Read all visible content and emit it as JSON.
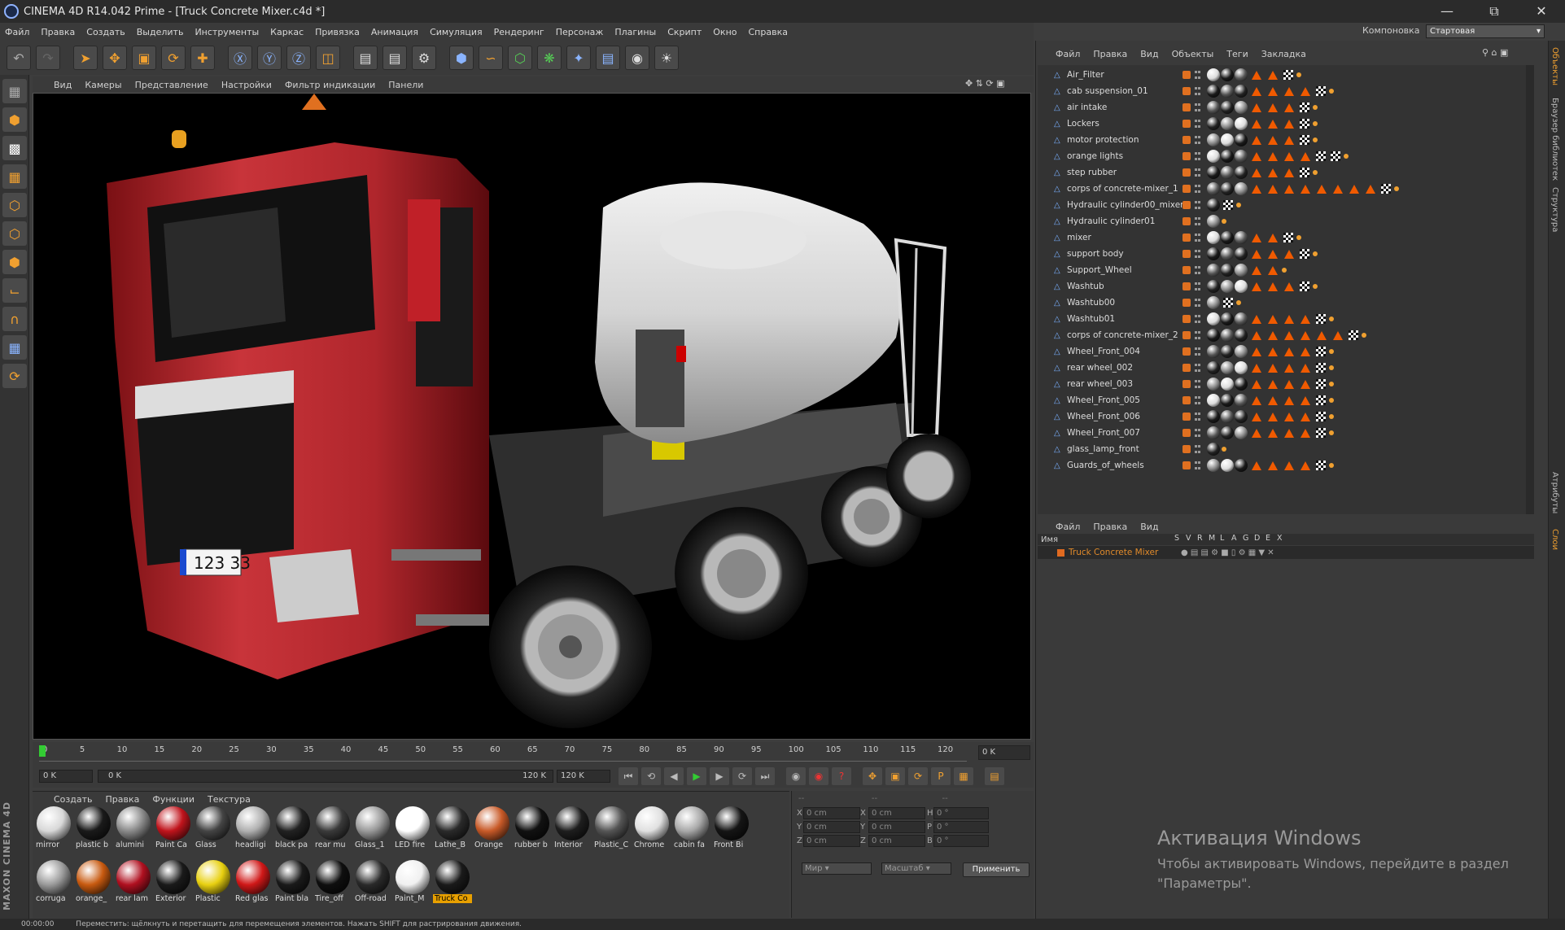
{
  "window": {
    "title": "CINEMA 4D R14.042 Prime - [Truck Concrete Mixer.c4d *]",
    "minimize_icon": "minimize-icon",
    "maximize_icon": "restore-icon",
    "close_icon": "close-icon"
  },
  "menubar": [
    "Файл",
    "Правка",
    "Создать",
    "Выделить",
    "Инструменты",
    "Каркас",
    "Привязка",
    "Анимация",
    "Симуляция",
    "Рендеринг",
    "Персонаж",
    "Плагины",
    "Скрипт",
    "Окно",
    "Справка"
  ],
  "layout": {
    "label": "Компоновка",
    "value": "Стартовая"
  },
  "viewport": {
    "menu": [
      "Вид",
      "Камеры",
      "Представление",
      "Настройки",
      "Фильтр индикации",
      "Панели"
    ],
    "plate": "123 33"
  },
  "timeline": {
    "ticks": [
      "0",
      "5",
      "10",
      "15",
      "20",
      "25",
      "30",
      "35",
      "40",
      "45",
      "50",
      "55",
      "60",
      "65",
      "70",
      "75",
      "80",
      "85",
      "90",
      "95",
      "100",
      "105",
      "110",
      "115",
      "120"
    ],
    "current_frame": "0 K",
    "start": "0 K",
    "range_start": "0 K",
    "range_end": "120 K",
    "end": "120 K"
  },
  "materials": {
    "menu": [
      "Создать",
      "Правка",
      "Функции",
      "Текстура"
    ],
    "items": [
      {
        "label": "mirror",
        "color": "#d8d8d8"
      },
      {
        "label": "plastic b",
        "color": "#1a1a1a"
      },
      {
        "label": "alumini",
        "color": "#8a8a8a"
      },
      {
        "label": "Paint Ca",
        "color": "#c0141c"
      },
      {
        "label": "Glass",
        "color": "#444444"
      },
      {
        "label": "headligi",
        "color": "#b0b0b0"
      },
      {
        "label": "black pa",
        "color": "#222222"
      },
      {
        "label": "rear mu",
        "color": "#3a3a3a"
      },
      {
        "label": "Glass_1",
        "color": "#9a9a9a"
      },
      {
        "label": "LED fire",
        "color": "#ffffff"
      },
      {
        "label": "Lathe_B",
        "color": "#2a2a2a"
      },
      {
        "label": "Orange",
        "color": "#c85a28"
      },
      {
        "label": "rubber b",
        "color": "#111111"
      },
      {
        "label": "Interior",
        "color": "#1e1e1e"
      },
      {
        "label": "Plastic_C",
        "color": "#555555"
      },
      {
        "label": "Chrome",
        "color": "#e0e0e0"
      },
      {
        "label": "cabin fa",
        "color": "#a8a8a8"
      },
      {
        "label": "Front Bi",
        "color": "#151515"
      },
      {
        "label": "corruga",
        "color": "#9a9a9a"
      },
      {
        "label": "orange_",
        "color": "#c85a10"
      },
      {
        "label": "rear lam",
        "color": "#b01020"
      },
      {
        "label": "Exterior",
        "color": "#1a1a1a"
      },
      {
        "label": "Plastic",
        "color": "#e8d010"
      },
      {
        "label": "Red glas",
        "color": "#d01818"
      },
      {
        "label": "Paint bla",
        "color": "#1a1a1a"
      },
      {
        "label": "Tire_off",
        "color": "#0f0f0f"
      },
      {
        "label": "Off-road",
        "color": "#2a2a2a"
      },
      {
        "label": "Paint_M",
        "color": "#f0f0f0"
      },
      {
        "label": "Truck Co",
        "color": "#1a1a1a",
        "selected": true
      }
    ]
  },
  "coords": {
    "rows": [
      {
        "a": "X",
        "av": "0 cm",
        "b": "X",
        "bv": "0 cm",
        "c": "H",
        "cv": "0 °"
      },
      {
        "a": "Y",
        "av": "0 cm",
        "b": "Y",
        "bv": "0 cm",
        "c": "P",
        "cv": "0 °"
      },
      {
        "a": "Z",
        "av": "0 cm",
        "b": "Z",
        "bv": "0 cm",
        "c": "B",
        "cv": "0 °"
      }
    ],
    "mode1": "Мир",
    "mode2": "Масштаб",
    "apply": "Применить"
  },
  "objects": {
    "menu": [
      "Файл",
      "Правка",
      "Вид",
      "Объекты",
      "Теги",
      "Закладка"
    ],
    "rows": [
      {
        "name": "Air_Filter",
        "tri": 2,
        "chk": 1,
        "dot": 1
      },
      {
        "name": "cab suspension_01",
        "tri": 4,
        "chk": 1,
        "dot": 1
      },
      {
        "name": "air intake",
        "tri": 3,
        "chk": 1,
        "dot": 1
      },
      {
        "name": "Lockers",
        "tri": 3,
        "chk": 1,
        "dot": 1
      },
      {
        "name": "motor protection",
        "tri": 3,
        "chk": 1,
        "dot": 1
      },
      {
        "name": "orange lights",
        "tri": 4,
        "chk": 2,
        "dot": 1
      },
      {
        "name": "step rubber",
        "tri": 3,
        "chk": 1,
        "dot": 1
      },
      {
        "name": "corps of concrete-mixer_1",
        "tri": 8,
        "chk": 1,
        "dot": 1
      },
      {
        "name": "Hydraulic cylinder00_mixer",
        "tri": 0,
        "chk": 1,
        "dot": 1
      },
      {
        "name": "Hydraulic cylinder01",
        "tri": 0,
        "chk": 0,
        "dot": 1
      },
      {
        "name": "mixer",
        "tri": 2,
        "chk": 1,
        "dot": 1
      },
      {
        "name": "support body",
        "tri": 3,
        "chk": 1,
        "dot": 1
      },
      {
        "name": "Support_Wheel",
        "tri": 2,
        "chk": 0,
        "dot": 1
      },
      {
        "name": "Washtub",
        "tri": 3,
        "chk": 1,
        "dot": 1
      },
      {
        "name": "Washtub00",
        "tri": 0,
        "chk": 1,
        "dot": 1
      },
      {
        "name": "Washtub01",
        "tri": 4,
        "chk": 1,
        "dot": 1
      },
      {
        "name": "corps of concrete-mixer_2",
        "tri": 6,
        "chk": 1,
        "dot": 1
      },
      {
        "name": "Wheel_Front_004",
        "tri": 4,
        "chk": 1,
        "dot": 1
      },
      {
        "name": "rear wheel_002",
        "tri": 4,
        "chk": 1,
        "dot": 1
      },
      {
        "name": "rear wheel_003",
        "tri": 4,
        "chk": 1,
        "dot": 1
      },
      {
        "name": "Wheel_Front_005",
        "tri": 4,
        "chk": 1,
        "dot": 1
      },
      {
        "name": "Wheel_Front_006",
        "tri": 4,
        "chk": 1,
        "dot": 1
      },
      {
        "name": "Wheel_Front_007",
        "tri": 4,
        "chk": 1,
        "dot": 1
      },
      {
        "name": "glass_lamp_front",
        "tri": 0,
        "chk": 0,
        "dot": 1
      },
      {
        "name": "Guards_of_wheels",
        "tri": 4,
        "chk": 1,
        "dot": 1
      }
    ]
  },
  "layers": {
    "menu": [
      "Файл",
      "Правка",
      "Вид"
    ],
    "header_name": "Имя",
    "columns": [
      "S",
      "V",
      "R",
      "M",
      "L",
      "A",
      "G",
      "D",
      "E",
      "X"
    ],
    "row_name": "Truck Concrete Mixer"
  },
  "side_tabs": [
    "Объекты",
    "Браузер библиотек",
    "Структура",
    "Атрибуты",
    "Слои"
  ],
  "activation": {
    "title": "Активация Windows",
    "line1": "Чтобы активировать Windows, перейдите в раздел",
    "line2": "\"Параметры\"."
  },
  "status": {
    "time": "00:00:00",
    "text": "Переместить: щёлкнуть и перетащить для перемещения элементов. Нажать SHIFT для растрирования движения."
  }
}
